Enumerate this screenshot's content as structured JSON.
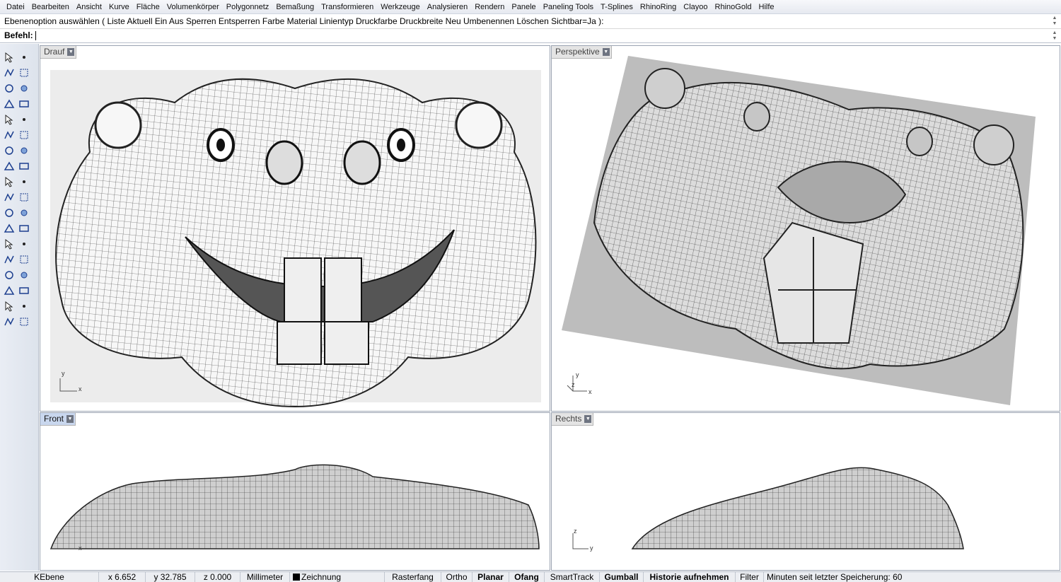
{
  "menu": [
    "Datei",
    "Bearbeiten",
    "Ansicht",
    "Kurve",
    "Fläche",
    "Volumenkörper",
    "Polygonnetz",
    "Bemaßung",
    "Transformieren",
    "Werkzeuge",
    "Analysieren",
    "Rendern",
    "Panele",
    "Paneling Tools",
    "T-Splines",
    "RhinoRing",
    "Clayoo",
    "RhinoGold",
    "Hilfe"
  ],
  "command": {
    "history": "Ebenenoption auswählen ( Liste  Aktuell  Ein  Aus  Sperren  Entsperren  Farbe  Material  Linientyp  Druckfarbe  Druckbreite  Neu  Umbenennen  Löschen  Sichtbar=Ja ):",
    "prompt": "Befehl:",
    "value": ""
  },
  "toolbar_icons": [
    "select-arrow-icon",
    "point-icon",
    "polyline-icon",
    "rectangle-select-icon",
    "circle-icon",
    "move-point-icon",
    "triangle-icon",
    "rectangle-icon",
    "ellipse-icon",
    "curve-icon",
    "box-edit-icon",
    "shield-icon",
    "solid-box-icon",
    "blend-icon",
    "cylinder-icon",
    "surface-icon",
    "gear-star-icon",
    "flare-icon",
    "network-icon",
    "extrude-icon",
    "fill-icon",
    "bubbles-icon",
    "rotate-icon",
    "rotate-arrow-icon",
    "text-icon",
    "dim-icon",
    "grid-4-icon",
    "tag-icon",
    "cube-icon",
    "ruler-icon",
    "array-icon",
    "stack-icon",
    "book-icon",
    "checkmark-icon",
    "lock-icon",
    "render-icon"
  ],
  "viewports": {
    "top": {
      "title": "Drauf",
      "axis_x": "x",
      "axis_y": "y"
    },
    "perspective": {
      "title": "Perspektive",
      "axis_x": "x",
      "axis_y": "y",
      "axis_z": "z"
    },
    "front": {
      "title": "Front",
      "axis_x": "x"
    },
    "right": {
      "title": "Rechts",
      "axis_x": "y",
      "axis_y": "z"
    }
  },
  "statusbar": {
    "layer": "KEbene",
    "x": "x 6.652",
    "y": "y 32.785",
    "z": "z 0.000",
    "unit": "Millimeter",
    "current_layer": "Zeichnung",
    "snap_grid": "Rasterfang",
    "ortho": "Ortho",
    "planar": "Planar",
    "osnap": "Ofang",
    "smarttrack": "SmartTrack",
    "gumball": "Gumball",
    "history": "Historie aufnehmen",
    "filter": "Filter",
    "save_info": "Minuten seit letzter Speicherung: 60"
  }
}
